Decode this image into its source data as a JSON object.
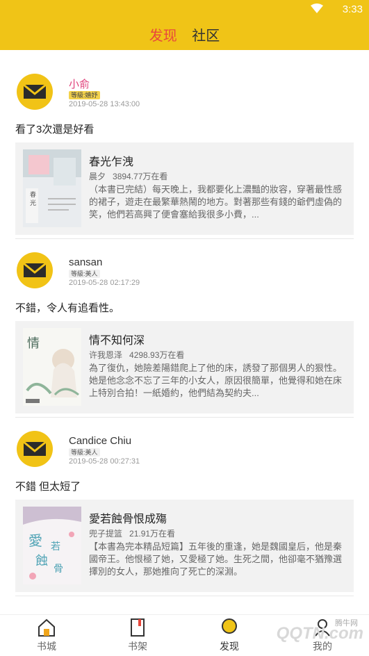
{
  "status_bar": {
    "time": "3:33"
  },
  "tabs": [
    {
      "label": "发现",
      "active": true
    },
    {
      "label": "社区",
      "active": false
    }
  ],
  "posts": [
    {
      "username": "小俞",
      "level": "等級:嬉妤",
      "timestamp": "2019-05-28 13:43:00",
      "comment": "看了3次還是好看",
      "book": {
        "title": "春光乍洩",
        "author": "晨夕",
        "views": "3894.77万在看",
        "description": "（本書已完結）每天晚上，我都要化上濃豔的妝容，穿著最性感的裙子，遊走在最繁華熱鬧的地方。對著那些有錢的爺們虛偽的笑，他們若高興了便會塞給我很多小費，..."
      }
    },
    {
      "username": "sansan",
      "level": "等級:美人",
      "timestamp": "2019-05-28 02:17:29",
      "comment": "不錯，令人有追看性。",
      "book": {
        "title": "情不知何深",
        "author": "许我恩泽",
        "views": "4298.93万在看",
        "description": "為了復仇，她險差陽錯爬上了他的床，誘發了那個男人的狠性。她是他念念不忘了三年的小女人，原因很簡單，他覺得和她在床上特別合拍！一紙婚約，他們結為契約夫..."
      }
    },
    {
      "username": "Candice Chiu",
      "level": "等級:美人",
      "timestamp": "2019-05-28 00:27:31",
      "comment": "不錯 但太短了",
      "book": {
        "title": "愛若蝕骨恨成殤",
        "author": "兜子提篮",
        "views": "21.91万在看",
        "description": "【本書為完本精品短篇】五年後的重逢，她是魏國皇后，他是秦國帝王。他恨極了她，又愛極了她。生死之間，他卻毫不猶豫選擇別的女人，那她推向了死亡的深淵。"
      }
    }
  ],
  "bottom_nav": [
    {
      "label": "书城",
      "icon": "house-icon"
    },
    {
      "label": "书架",
      "icon": "bookshelf-icon"
    },
    {
      "label": "发现",
      "icon": "discover-icon"
    },
    {
      "label": "我的",
      "icon": "profile-icon"
    }
  ],
  "watermark": {
    "text": "QQTN.com",
    "small": "腾牛网"
  },
  "colors": {
    "accent": "#f0c417",
    "tab_active": "#e8473c",
    "username_pink": "#e0417a"
  }
}
